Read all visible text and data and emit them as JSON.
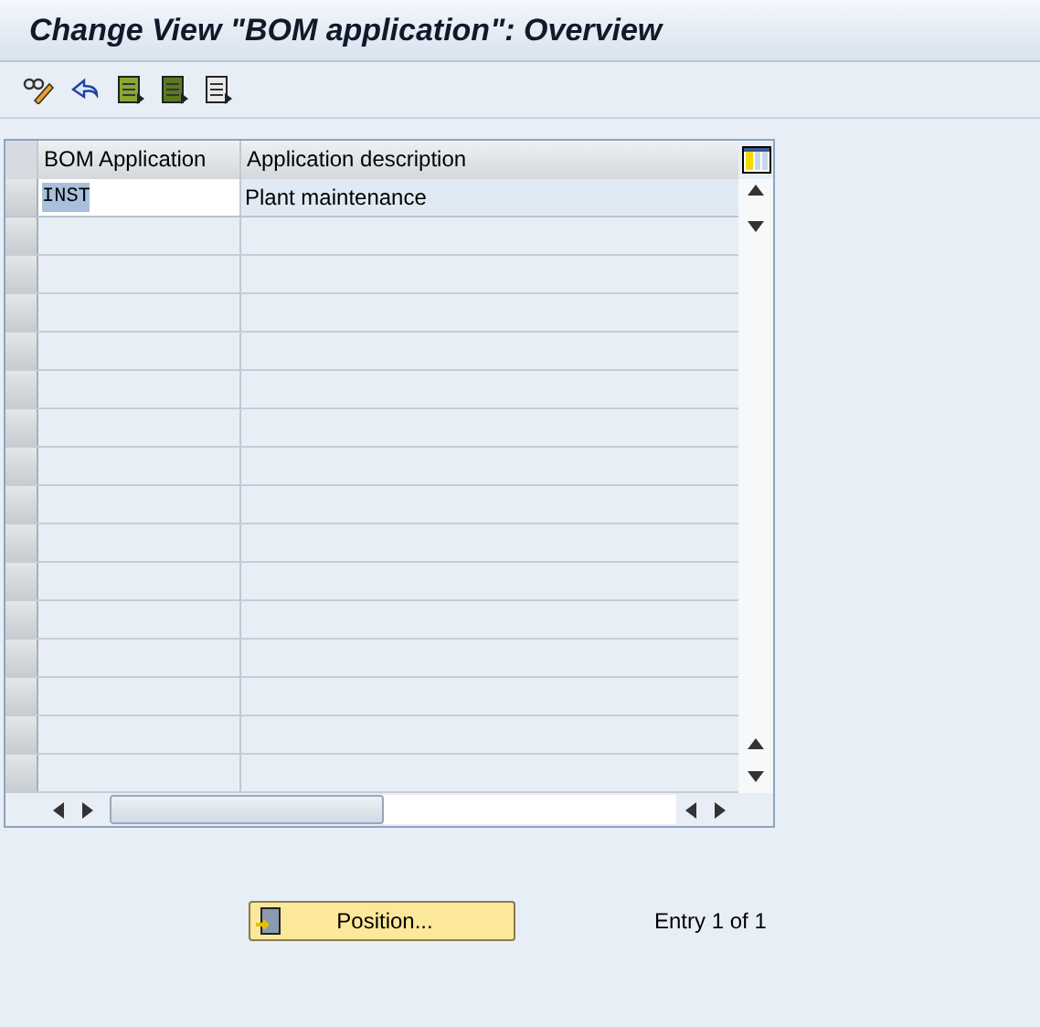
{
  "window": {
    "title": "Change View \"BOM application\": Overview"
  },
  "toolbar": [
    {
      "kind": "edit"
    },
    {
      "kind": "undo"
    },
    {
      "kind": "select_all"
    },
    {
      "kind": "select_block"
    },
    {
      "kind": "deselect_all"
    }
  ],
  "table": {
    "columns": [
      "BOM Application",
      "Application description"
    ],
    "rows": [
      {
        "cells": [
          "INST",
          "Plant maintenance"
        ],
        "selected": true
      }
    ]
  },
  "position_button": {
    "label": "Position..."
  },
  "status": "Entry 1 of 1"
}
